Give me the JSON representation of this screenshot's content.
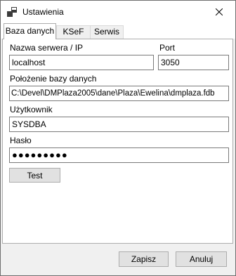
{
  "window": {
    "title": "Ustawienia"
  },
  "tabs": [
    {
      "label": "Baza danych",
      "active": true
    },
    {
      "label": "KSeF",
      "active": false
    },
    {
      "label": "Serwis",
      "active": false
    }
  ],
  "form": {
    "server_label": "Nazwa serwera / IP",
    "server_value": "localhost",
    "port_label": "Port",
    "port_value": "3050",
    "dbpath_label": "Położenie bazy danych",
    "dbpath_value": "C:\\Devel\\DMPlaza2005\\dane\\Plaza\\Ewelina\\dmplaza.fdb",
    "user_label": "Użytkownik",
    "user_value": "SYSDBA",
    "password_label": "Hasło",
    "password_value": "●●●●●●●●●",
    "test_button": "Test"
  },
  "footer": {
    "save_button": "Zapisz",
    "cancel_button": "Anuluj"
  },
  "icons": {
    "app": "app-window-icon",
    "close": "close-icon"
  }
}
